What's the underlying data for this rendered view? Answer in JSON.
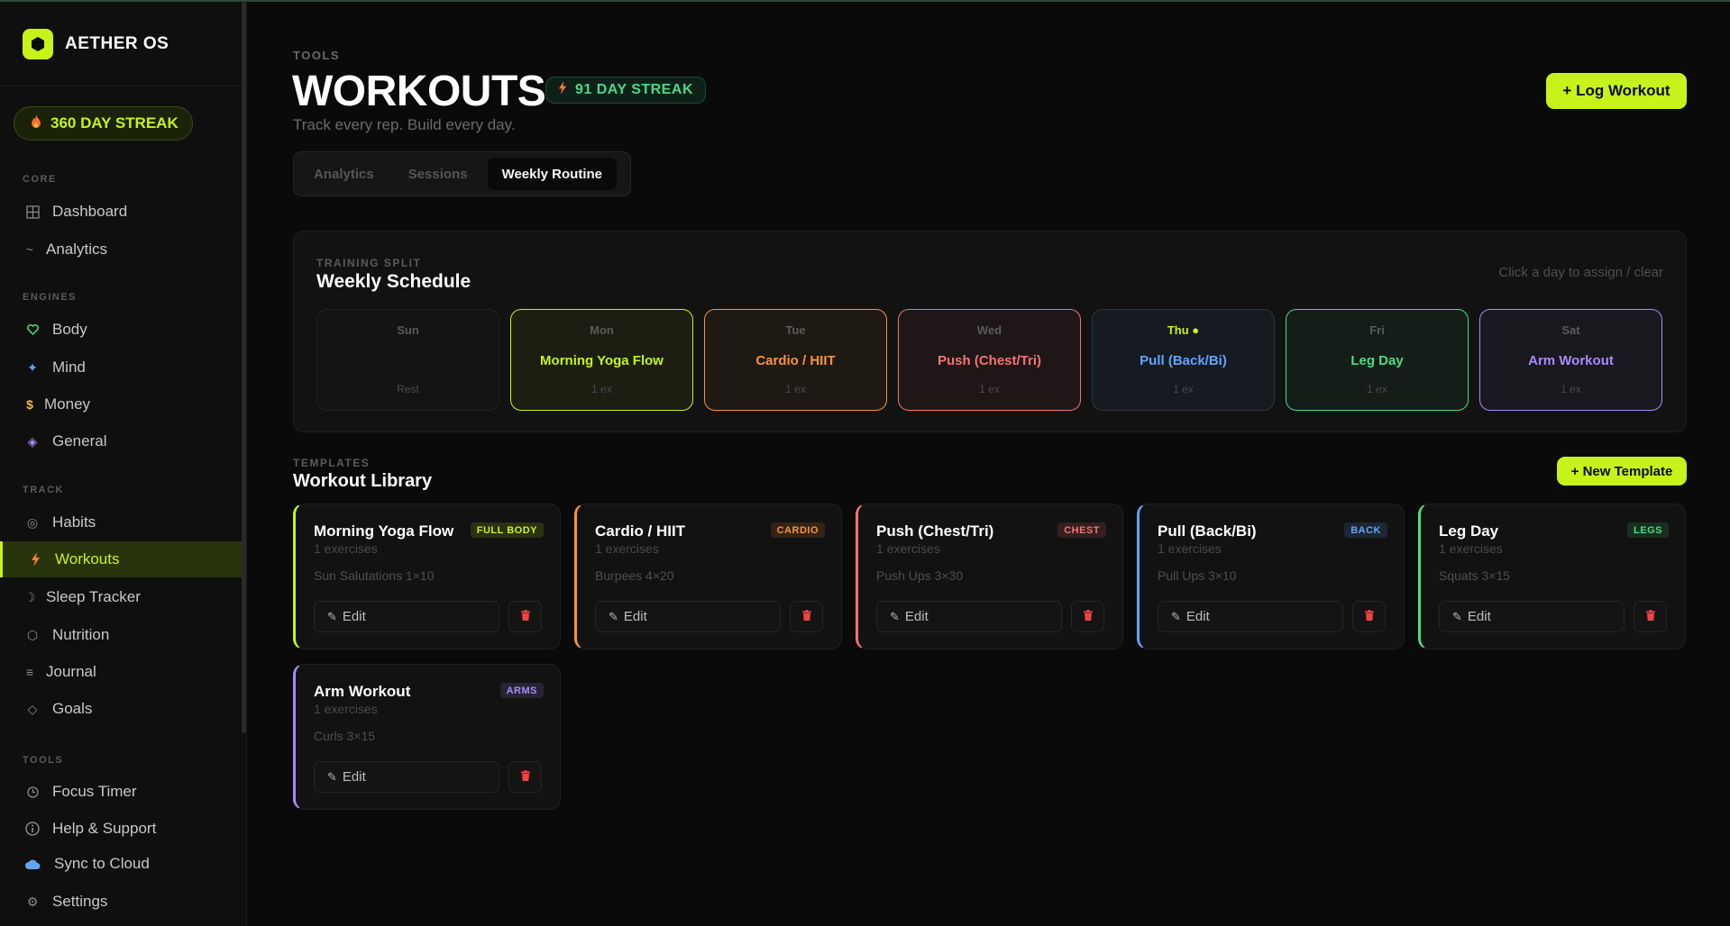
{
  "app": {
    "name": "AETHER OS"
  },
  "sidebar": {
    "streak": "360 DAY STREAK",
    "sections": {
      "core": "CORE",
      "engines": "ENGINES",
      "track": "TRACK",
      "tools": "TOOLS"
    },
    "items": {
      "dashboard": "Dashboard",
      "analytics": "Analytics",
      "body": "Body",
      "mind": "Mind",
      "money": "Money",
      "general": "General",
      "habits": "Habits",
      "workouts": "Workouts",
      "sleep": "Sleep Tracker",
      "nutrition": "Nutrition",
      "journal": "Journal",
      "goals": "Goals",
      "focus": "Focus Timer",
      "help": "Help & Support",
      "sync": "Sync to Cloud",
      "settings": "Settings"
    }
  },
  "header": {
    "eyebrow": "TOOLS",
    "title": "WORKOUTS",
    "streak": "91 DAY STREAK",
    "subtitle": "Track every rep. Build every day.",
    "log_button": "+ Log Workout"
  },
  "tabs": {
    "analytics": "Analytics",
    "sessions": "Sessions",
    "weekly": "Weekly Routine",
    "active": "Weekly Routine"
  },
  "schedule": {
    "eyebrow": "TRAINING SPLIT",
    "title": "Weekly Schedule",
    "hint": "Click a day to assign / clear",
    "days": [
      {
        "day": "Sun",
        "workout": "",
        "count": "Rest",
        "color": "#5a5a5a"
      },
      {
        "day": "Mon",
        "workout": "Morning Yoga Flow",
        "count": "1 ex",
        "color": "#c6f31a"
      },
      {
        "day": "Tue",
        "workout": "Cardio / HIIT",
        "count": "1 ex",
        "color": "#fb923c"
      },
      {
        "day": "Wed",
        "workout": "Push (Chest/Tri)",
        "count": "1 ex",
        "color": "#f87171"
      },
      {
        "day": "Thu ●",
        "workout": "Pull (Back/Bi)",
        "count": "1 ex",
        "color": "#60a5fa"
      },
      {
        "day": "Fri",
        "workout": "Leg Day",
        "count": "1 ex",
        "color": "#4ade80"
      },
      {
        "day": "Sat",
        "workout": "Arm Workout",
        "count": "1 ex",
        "color": "#a78bfa"
      }
    ]
  },
  "templates": {
    "eyebrow": "TEMPLATES",
    "title": "Workout Library",
    "new_button": "+ New Template",
    "edit_label": "Edit",
    "cards": [
      {
        "name": "Morning Yoga Flow",
        "tag": "FULL BODY",
        "count": "1 exercises",
        "exercise": "Sun Salutations 1×10",
        "color": "#c6f31a"
      },
      {
        "name": "Cardio / HIIT",
        "tag": "CARDIO",
        "count": "1 exercises",
        "exercise": "Burpees 4×20",
        "color": "#fb923c"
      },
      {
        "name": "Push (Chest/Tri)",
        "tag": "CHEST",
        "count": "1 exercises",
        "exercise": "Push Ups 3×30",
        "color": "#f87171"
      },
      {
        "name": "Pull (Back/Bi)",
        "tag": "BACK",
        "count": "1 exercises",
        "exercise": "Pull Ups 3×10",
        "color": "#60a5fa"
      },
      {
        "name": "Leg Day",
        "tag": "LEGS",
        "count": "1 exercises",
        "exercise": "Squats 3×15",
        "color": "#4ade80"
      },
      {
        "name": "Arm Workout",
        "tag": "ARMS",
        "count": "1 exercises",
        "exercise": "Curls 3×15",
        "color": "#a78bfa"
      }
    ]
  },
  "colors": {
    "accent": "#c6f31a",
    "background": "#0a0a0a",
    "streak_green": "#4bd888",
    "danger": "#ef4444"
  }
}
